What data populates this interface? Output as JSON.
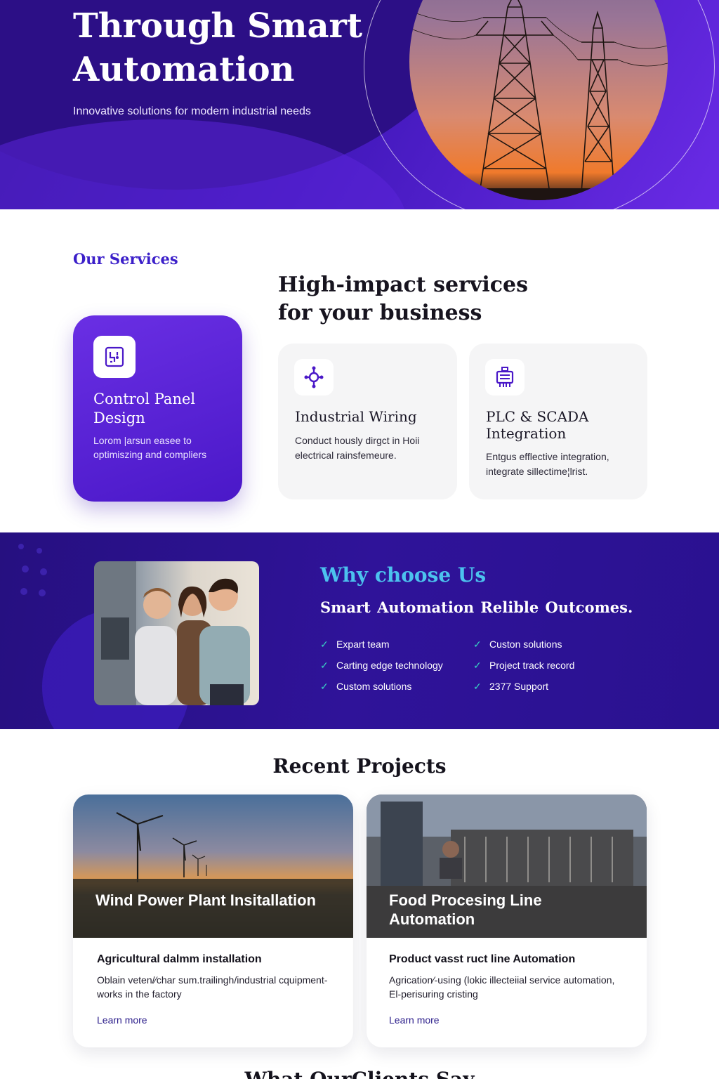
{
  "hero": {
    "title": "Through Smart Automation",
    "subtitle": "Innovative solutions for modern industrial needs"
  },
  "services": {
    "kicker": "Our Services",
    "heading": "High-impact services for your business",
    "cards": [
      {
        "title": "Control Panel Design",
        "description": "Lorom |arsun easee to optimiszing and compliers",
        "icon": "control-panel-icon"
      },
      {
        "title": "Industrial Wiring",
        "description": "Conduct hously dirgct in Hoii electrical rainsfemeure.",
        "icon": "wiring-icon"
      },
      {
        "title": "PLC & SCADA Integration",
        "description": "Entgus efflective integration, integrate sillectime¦lrist.",
        "icon": "plc-icon"
      }
    ]
  },
  "why": {
    "kicker": "Why choose Us",
    "subtitle": "Smart Automation  Relible Outcomes.",
    "left_list": [
      "Expart team",
      "Carting edge technology",
      "Custom solutions"
    ],
    "right_list": [
      "Custon solutions",
      "Project track record",
      "2377 Support"
    ]
  },
  "projects": {
    "heading": "Recent Projects",
    "items": [
      {
        "caption": "Wind Power Plant Insitallation",
        "title": "Agricultural dalmm installation",
        "description": "Oblain veten/∕char sum.trailingh/industrial cquipment-works in the factory",
        "link": "Learn more"
      },
      {
        "caption": "Food Procesing Line Automation",
        "title": "Product vasst ruct line Automation",
        "description": "Agrication∕-using (Ɩokic illecteiial service automation, El-perisuring cristing",
        "link": "Learn more"
      }
    ]
  },
  "clients": {
    "heading": "What OurClients Say"
  },
  "colors": {
    "brand_purple": "#4a18c8",
    "hero_dark": "#2a1188",
    "accent_cyan": "#4cc2ee",
    "check_teal": "#39d1c4"
  }
}
